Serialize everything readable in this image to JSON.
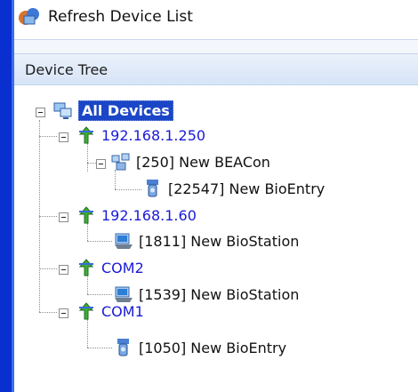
{
  "toolbar": {
    "refresh_label": "Refresh Device List",
    "refresh_icon": "refresh-device-icon"
  },
  "panel": {
    "title": "Device Tree"
  },
  "tree": {
    "root": {
      "label": "All Devices",
      "icon": "network-computers-icon"
    },
    "hosts": [
      {
        "label": "192.168.1.250",
        "icon": "connection-arrow-icon"
      },
      {
        "label": "[250] New BEACon",
        "icon": "beacon-device-icon"
      },
      {
        "label": "[22547] New BioEntry",
        "icon": "bioentry-device-icon"
      },
      {
        "label": "192.168.1.60",
        "icon": "connection-arrow-icon"
      },
      {
        "label": "[1811] New BioStation",
        "icon": "biostation-device-icon"
      },
      {
        "label": "COM2",
        "icon": "connection-arrow-icon"
      },
      {
        "label": "[1539] New BioStation",
        "icon": "biostation-device-icon"
      },
      {
        "label": "COM1",
        "icon": "connection-arrow-icon"
      },
      {
        "label": "[1050] New BioEntry",
        "icon": "bioentry-device-icon"
      }
    ]
  },
  "colors": {
    "host_text": "#1a1ad8",
    "selection": "#1b46c7",
    "border": "#0a2fd0"
  }
}
